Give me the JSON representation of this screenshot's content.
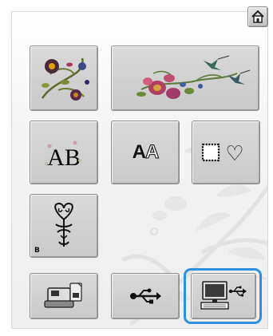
{
  "buttons": {
    "monogram_ab_text": "AB",
    "font_aa_solid": "A",
    "font_aa_outline": "A",
    "border_heart_text": "♡",
    "b_pattern_label": "B"
  },
  "selected": "computer-button",
  "colors": {
    "selection_ring": "#2f8fe0",
    "button_face": "#cfcfcf",
    "button_border": "#8e8e8e"
  },
  "icons": {
    "home": "home-icon",
    "floral_1": "floral-embroidery-icon",
    "floral_2": "hummingbird-floral-icon",
    "monogram": "floral-alphabet-icon",
    "fonts": "font-letters-icon",
    "frames": "frame-pattern-icon",
    "b_pattern": "heart-ornament-icon",
    "machine": "embroidery-machine-icon",
    "usb": "usb-icon",
    "computer": "computer-usb-icon"
  }
}
